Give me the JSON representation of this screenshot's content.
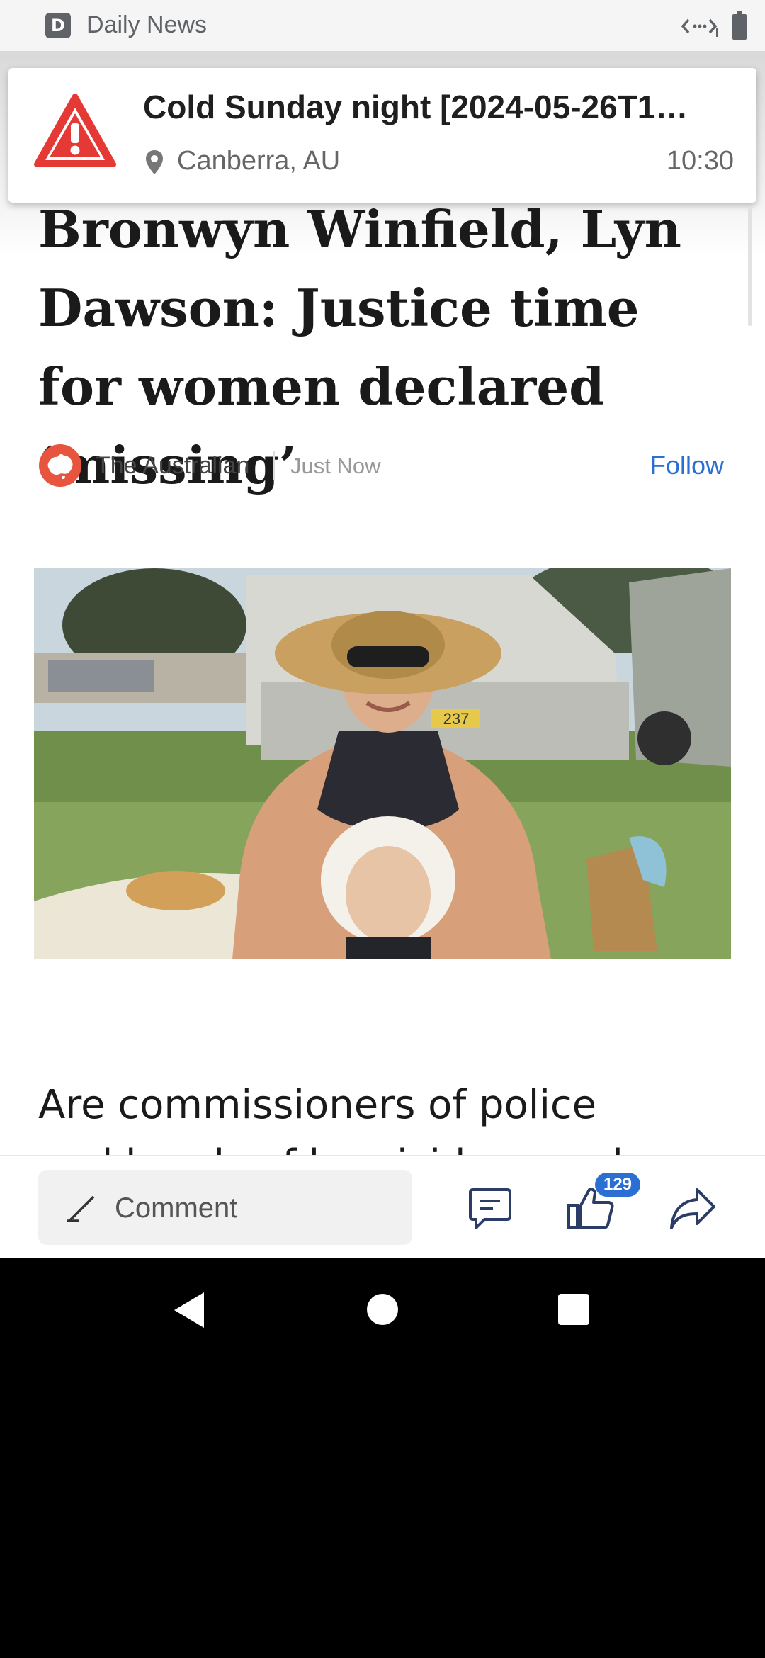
{
  "status_bar": {
    "app_icon_letter": "D",
    "app_name": "Daily News",
    "icons": [
      "network-icon",
      "battery-icon"
    ]
  },
  "notification": {
    "icon": "warning-triangle-icon",
    "title": "Cold Sunday night [2024-05-26T1…",
    "location_icon": "map-pin-icon",
    "location": "Canberra, AU",
    "time": "10:30",
    "colors": {
      "alert": "#e53935"
    }
  },
  "article": {
    "headline": "Bronwyn Winfield, Lyn Dawson: Justice time for women declared ‘missing’",
    "source": {
      "logo_icon": "the-australian-logo-icon",
      "name": "The Australian",
      "timestamp": "Just Now",
      "follow_label": "Follow"
    },
    "image": {
      "icon": "photo-woman-with-baby",
      "plate_text": "237"
    },
    "body_first_line": "Are commissioners of police",
    "body_partial_line": "and heads of homicide squads"
  },
  "action_bar": {
    "comment_placeholder": "Comment",
    "like_count": "129",
    "icons": [
      "pencil-icon",
      "comments-icon",
      "like-icon",
      "share-icon"
    ],
    "colors": {
      "accent": "#2a6fd1"
    }
  },
  "nav_bar": {
    "icons": [
      "back-icon",
      "home-icon",
      "recents-icon"
    ]
  }
}
